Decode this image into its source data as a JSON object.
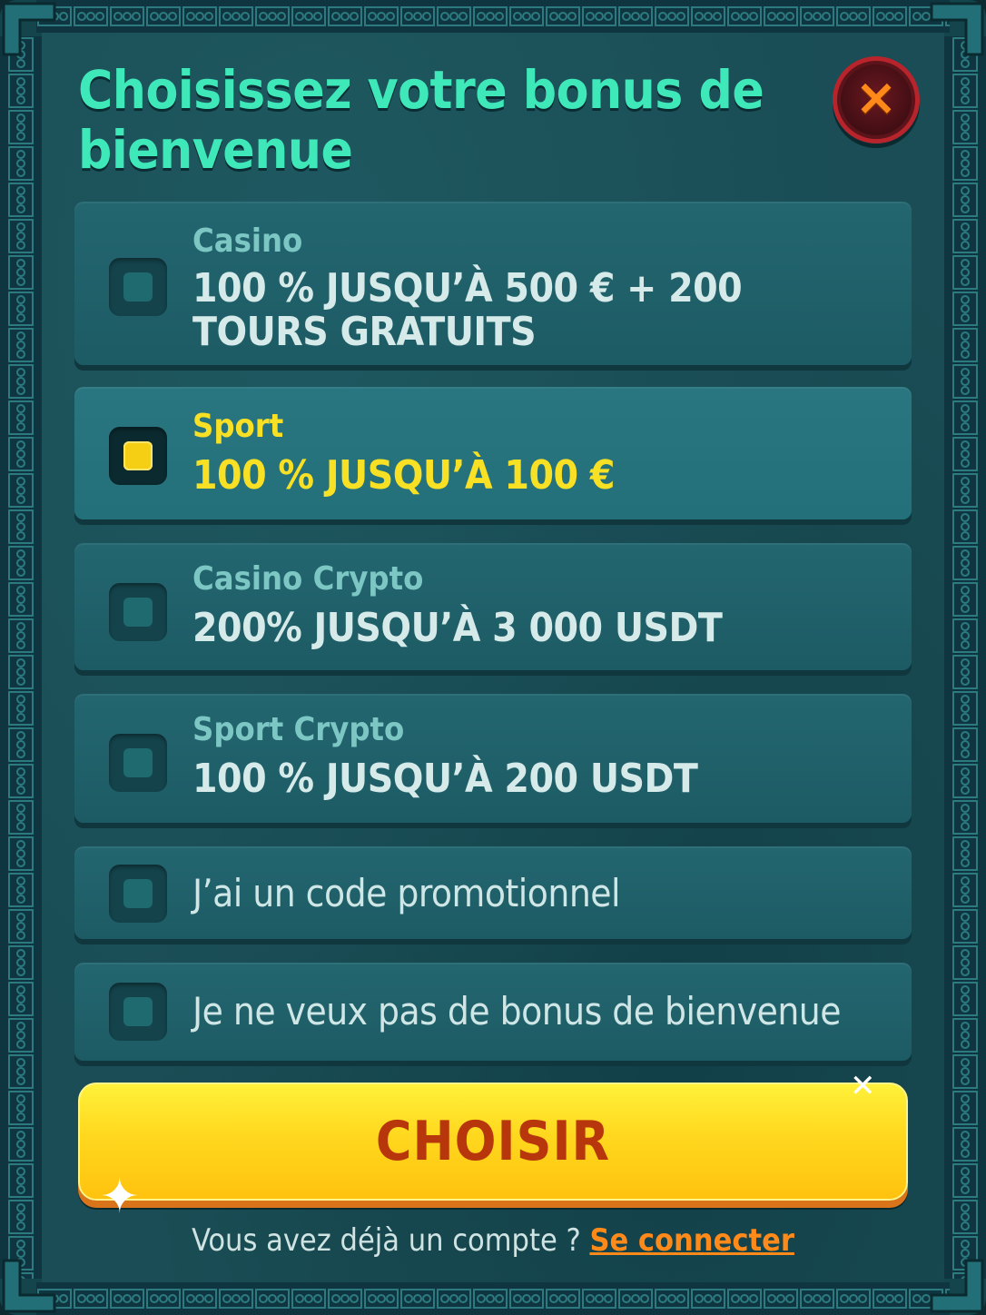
{
  "dialog": {
    "title": "Choisissez votre bonus de bienvenue",
    "close_icon": "×"
  },
  "options": [
    {
      "category": "Casino",
      "text": "100 % JUSQU’À 500 € + 200 TOURS GRATUITS",
      "selected": false
    },
    {
      "category": "Sport",
      "text": "100 % JUSQU’À 100 €",
      "selected": true
    },
    {
      "category": "Casino Crypto",
      "text": "200% JUSQU’À 3 000 USDT",
      "selected": false
    },
    {
      "category": "Sport Crypto",
      "text": "100 % JUSQU’À 200 USDT",
      "selected": false
    },
    {
      "category": "",
      "text": "J’ai un code promotionnel",
      "selected": false
    },
    {
      "category": "",
      "text": "Je ne veux pas de bonus de bienvenue",
      "selected": false
    }
  ],
  "cta": {
    "label": "CHOISIR"
  },
  "footer": {
    "prompt": "Vous avez déjà un compte ? ",
    "link": "Se connecter"
  },
  "colors": {
    "title": "#3ee8b8",
    "selected": "#f8e024",
    "cta": "#ffd81e",
    "cta_text": "#b8360c",
    "link": "#ff8a1a"
  }
}
